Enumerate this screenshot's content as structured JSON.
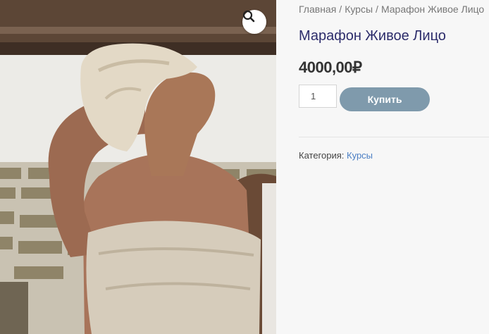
{
  "gallery": {
    "image_alt": "Woman with towel wrapped around her head and body",
    "zoom_icon": "magnifier-icon"
  },
  "breadcrumb": {
    "items": [
      "Главная",
      "Курсы",
      "Марафон Живое Лицо"
    ],
    "separator": "/"
  },
  "product": {
    "title": "Марафон Живое Лицо",
    "price": "4000,00₽",
    "quantity": "1",
    "buy_label": "Купить",
    "category_label": "Категория:",
    "category_value": "Курсы"
  },
  "colors": {
    "title": "#2c2c6b",
    "button": "#7f9aac",
    "link": "#4a7ec4"
  }
}
